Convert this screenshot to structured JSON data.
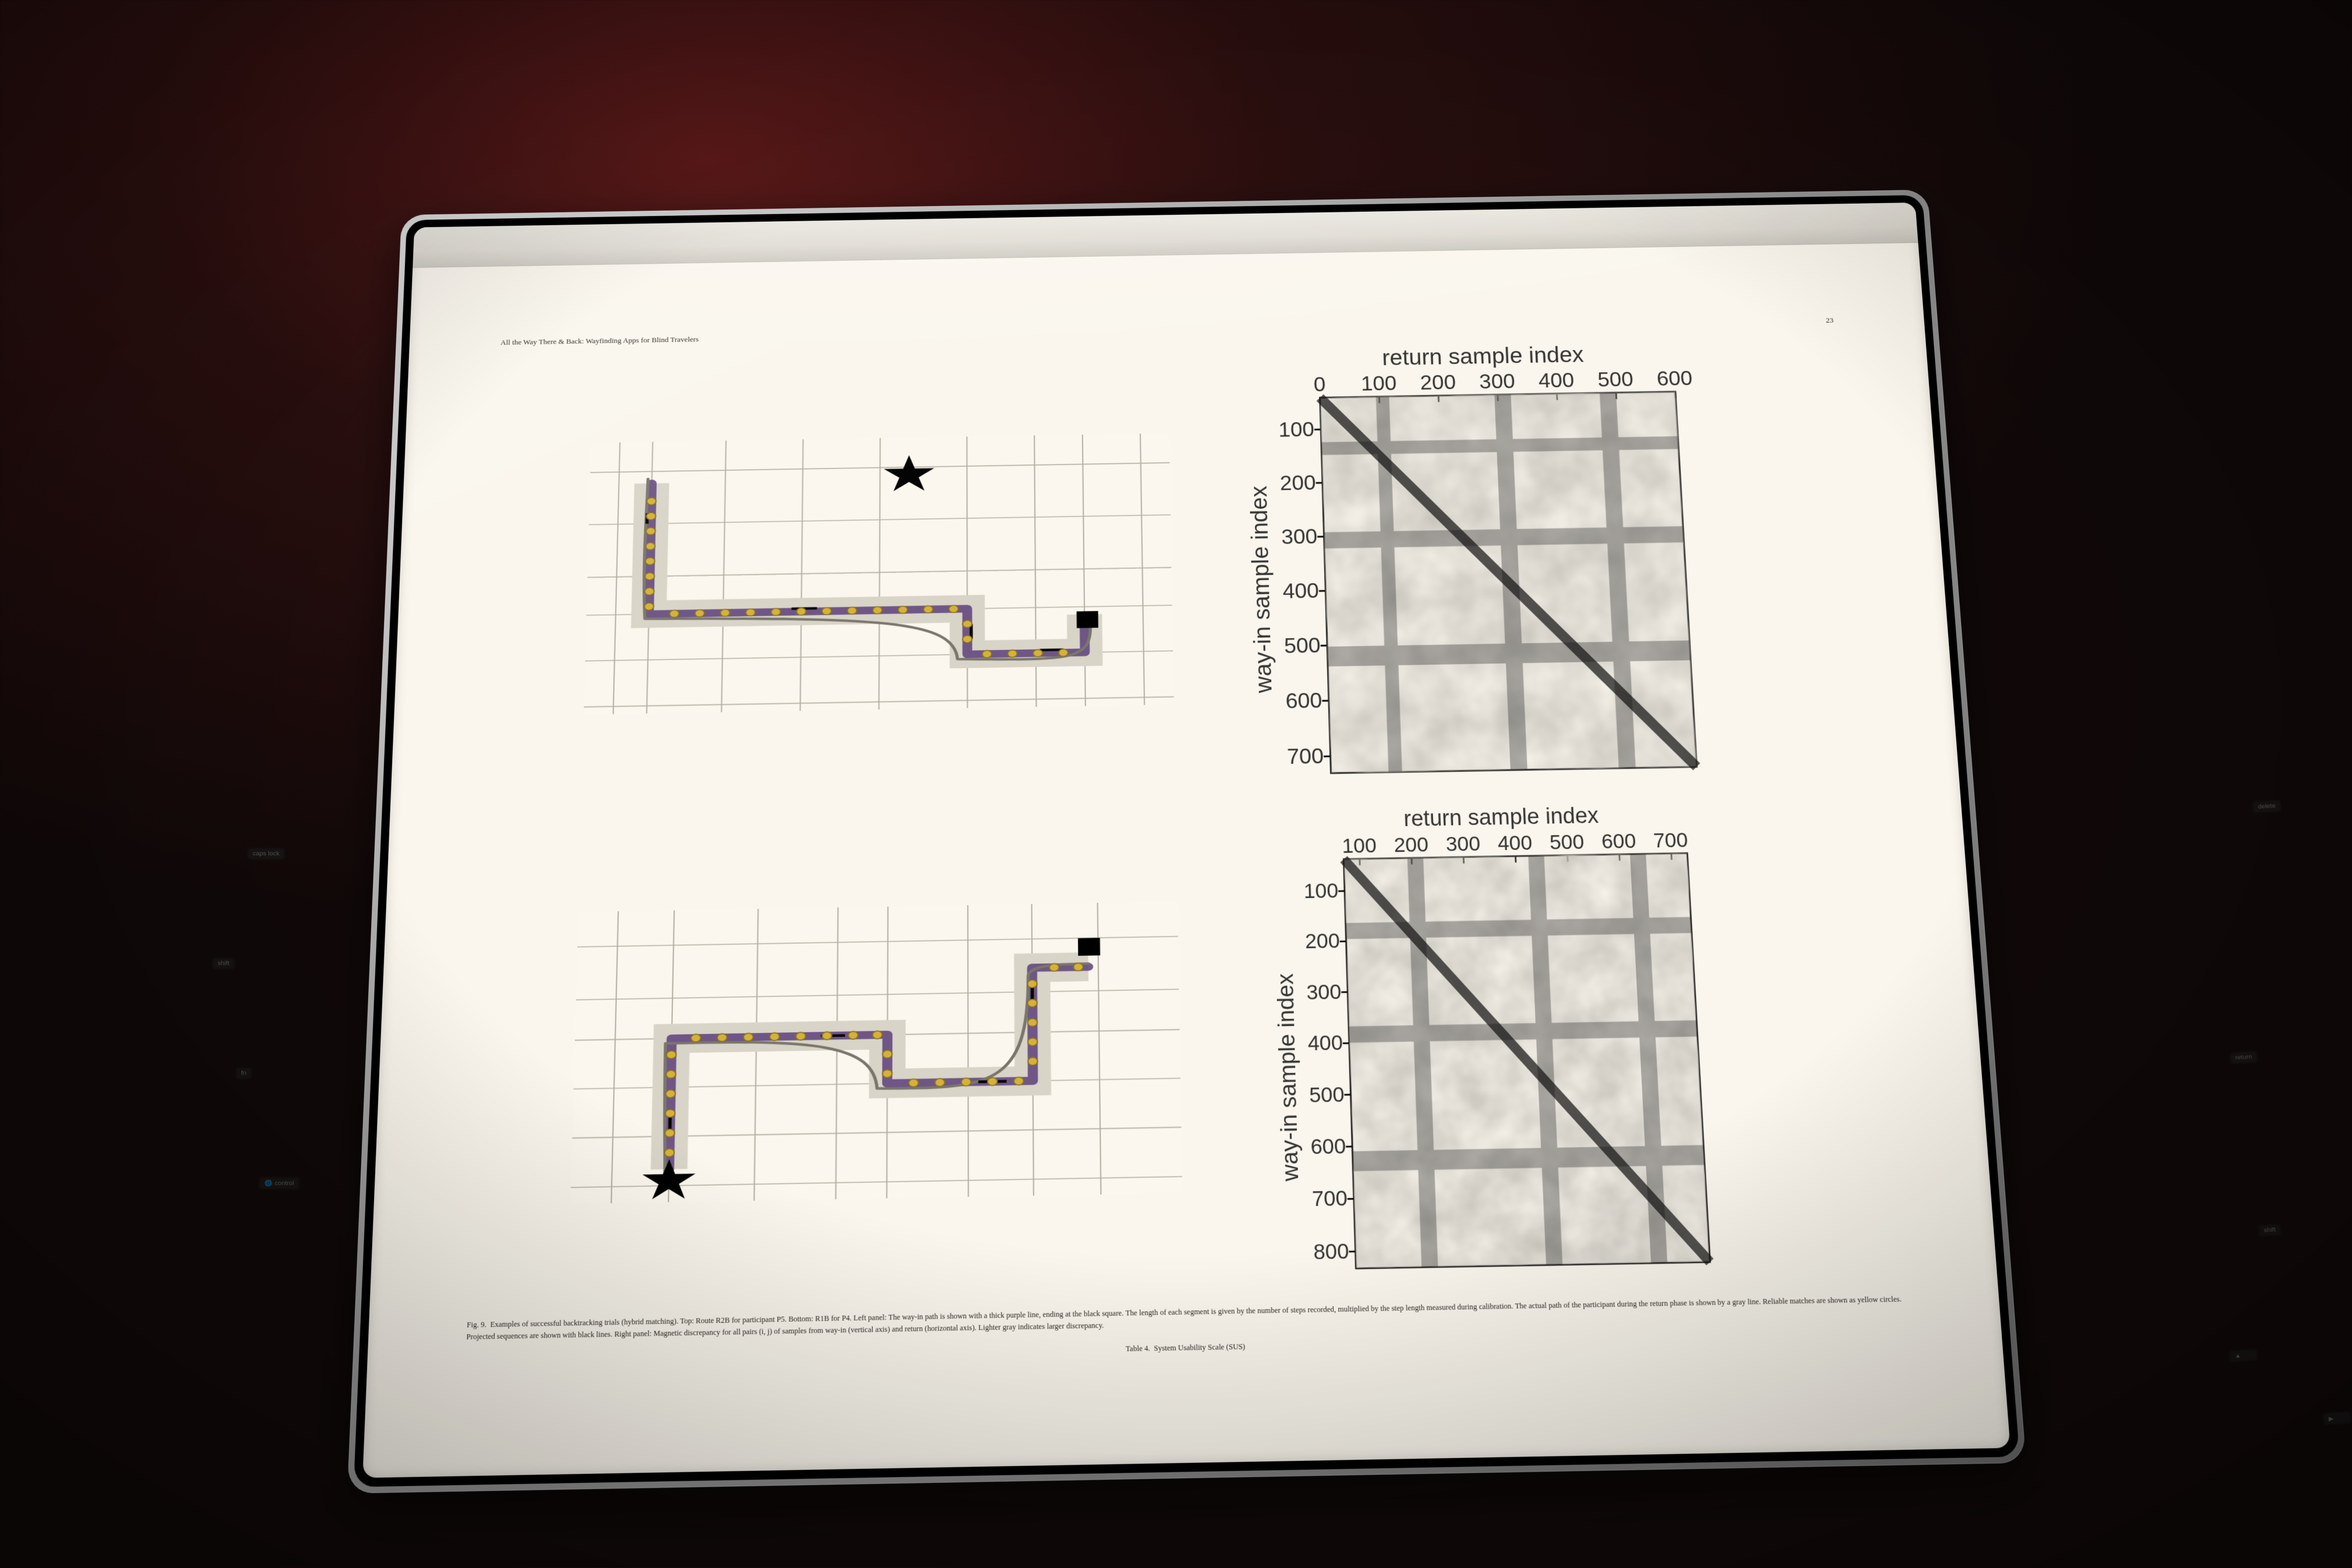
{
  "background": {
    "keys_left": [
      "caps lock",
      "shift",
      "fn",
      "control"
    ],
    "keys_right": [
      "delete",
      "return",
      "shift"
    ],
    "globe_symbol": "🌐"
  },
  "paper": {
    "running_title": "All the Way There & Back: Wayfinding Apps for Blind Travelers",
    "page_number": "23",
    "figure_label": "Fig. 9.",
    "figure_caption": "Examples of successful backtracking trials (hybrid matching). Top: Route R2B for participant P5. Bottom: R1B for P4. Left panel: The way-in path is shown with a thick purple line, ending at the black square. The length of each segment is given by the number of steps recorded, multiplied by the step length measured during calibration. The actual path of the participant during the return phase is shown by a gray line. Reliable matches are shown as yellow circles. Projected sequences are shown with black lines. Right panel: Magnetic discrepancy for all pairs (i, j) of samples from way-in (vertical axis) and return (horizontal axis). Lighter gray indicates larger discrepancy.",
    "table_label": "Table 4.",
    "table_title_fragment": "System Usability Scale (SUS)"
  },
  "heatmaps": {
    "x_axis_label": "return sample index",
    "y_axis_label": "way-in sample index",
    "top": {
      "x_ticks": [
        "0",
        "100",
        "200",
        "300",
        "400",
        "500",
        "600"
      ],
      "y_ticks": [
        "100",
        "200",
        "300",
        "400",
        "500",
        "600",
        "700"
      ]
    },
    "bottom": {
      "x_ticks": [
        "100",
        "200",
        "300",
        "400",
        "500",
        "600",
        "700"
      ],
      "y_ticks": [
        "100",
        "200",
        "300",
        "400",
        "500",
        "600",
        "700",
        "800"
      ]
    }
  },
  "chart_data": [
    {
      "type": "heatmap",
      "name": "Magnetic discrepancy — R2B / P5",
      "xlabel": "return sample index",
      "ylabel": "way-in sample index",
      "xlim": [
        0,
        600
      ],
      "ylim": [
        0,
        750
      ],
      "x_ticks": [
        0,
        100,
        200,
        300,
        400,
        500,
        600
      ],
      "y_ticks": [
        100,
        200,
        300,
        400,
        500,
        600,
        700
      ],
      "note": "grayscale; lighter = larger discrepancy; dark anti-diagonal ridge",
      "diagonal_ridge": {
        "from": [
          0,
          0
        ],
        "to": [
          600,
          750
        ]
      }
    },
    {
      "type": "heatmap",
      "name": "Magnetic discrepancy — R1B / P4",
      "xlabel": "return sample index",
      "ylabel": "way-in sample index",
      "xlim": [
        0,
        750
      ],
      "ylim": [
        0,
        800
      ],
      "x_ticks": [
        100,
        200,
        300,
        400,
        500,
        600,
        700
      ],
      "y_ticks": [
        100,
        200,
        300,
        400,
        500,
        600,
        700,
        800
      ],
      "note": "grayscale; lighter = larger discrepancy; dark anti-diagonal ridge",
      "diagonal_ridge": {
        "from": [
          0,
          0
        ],
        "to": [
          750,
          800
        ]
      }
    },
    {
      "type": "line",
      "name": "Way-in path — R2B / P5 (top-left map panel)",
      "note": "schematic floor-plan coordinates (arbitrary units)",
      "series": [
        {
          "name": "way-in (purple)",
          "xy": [
            [
              32,
              28
            ],
            [
              32,
              115
            ],
            [
              195,
              115
            ],
            [
              195,
              145
            ],
            [
              255,
              145
            ],
            [
              255,
              125
            ]
          ]
        },
        {
          "name": "return (gray)",
          "xy": [
            [
              255,
              125
            ],
            [
              255,
              148
            ],
            [
              190,
              148
            ],
            [
              190,
              118
            ],
            [
              30,
              118
            ],
            [
              30,
              25
            ]
          ]
        }
      ],
      "endpoints": {
        "star": [
          165,
          25
        ],
        "square": [
          258,
          125
        ]
      }
    },
    {
      "type": "line",
      "name": "Way-in path — R1B / P4 (bottom-left map panel)",
      "note": "schematic floor-plan coordinates (arbitrary units)",
      "series": [
        {
          "name": "way-in (purple)",
          "xy": [
            [
              48,
              160
            ],
            [
              48,
              80
            ],
            [
              155,
              80
            ],
            [
              155,
              110
            ],
            [
              227,
              110
            ],
            [
              227,
              40
            ],
            [
              255,
              40
            ]
          ]
        },
        {
          "name": "return (gray)",
          "xy": [
            [
              255,
              40
            ],
            [
              225,
              40
            ],
            [
              225,
              113
            ],
            [
              150,
              113
            ],
            [
              150,
              83
            ],
            [
              45,
              83
            ],
            [
              45,
              160
            ]
          ]
        }
      ],
      "endpoints": {
        "star": [
          48,
          165
        ],
        "square": [
          255,
          28
        ]
      }
    }
  ],
  "colors": {
    "page": "#faf6ed",
    "grid": "#b3aea2",
    "corridor": "#d9d4c8",
    "wayin": "#5c3f7a",
    "return": "#7a766d",
    "match": "#d4b23a"
  }
}
